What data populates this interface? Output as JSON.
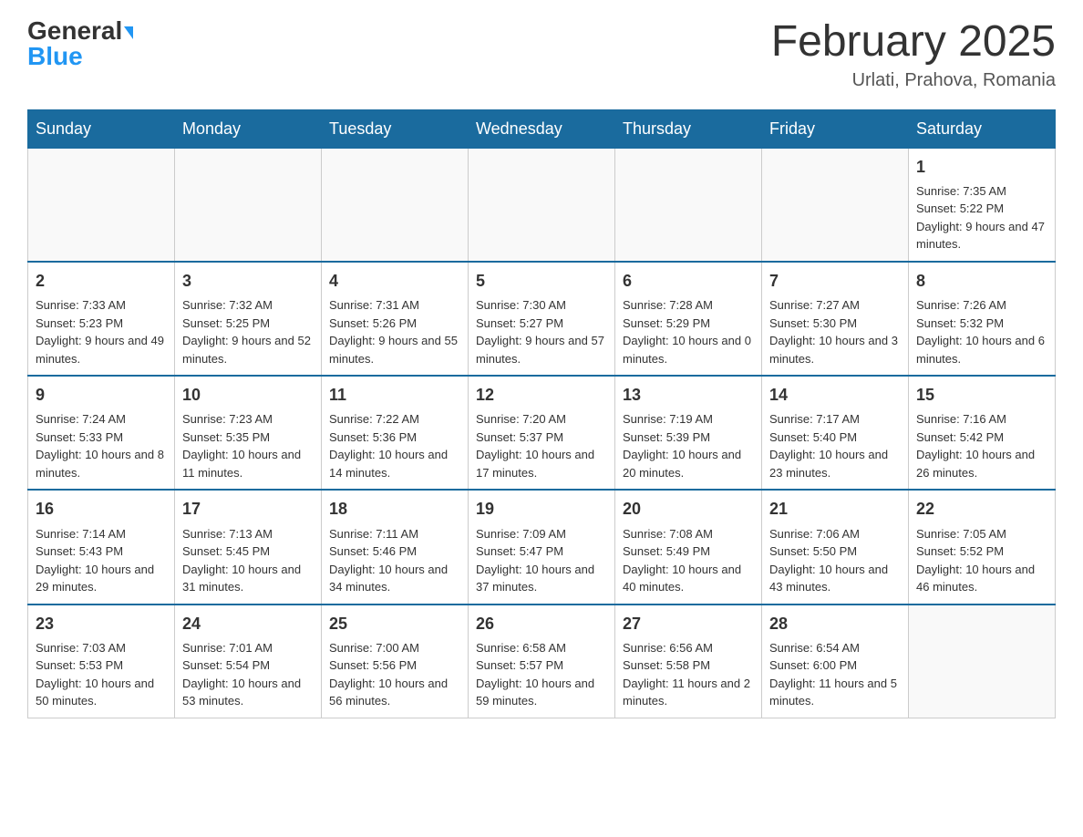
{
  "header": {
    "logo_general": "General",
    "logo_blue": "Blue",
    "month_year": "February 2025",
    "location": "Urlati, Prahova, Romania"
  },
  "days_of_week": [
    "Sunday",
    "Monday",
    "Tuesday",
    "Wednesday",
    "Thursday",
    "Friday",
    "Saturday"
  ],
  "weeks": [
    [
      {
        "day": "",
        "info": ""
      },
      {
        "day": "",
        "info": ""
      },
      {
        "day": "",
        "info": ""
      },
      {
        "day": "",
        "info": ""
      },
      {
        "day": "",
        "info": ""
      },
      {
        "day": "",
        "info": ""
      },
      {
        "day": "1",
        "info": "Sunrise: 7:35 AM\nSunset: 5:22 PM\nDaylight: 9 hours and 47 minutes."
      }
    ],
    [
      {
        "day": "2",
        "info": "Sunrise: 7:33 AM\nSunset: 5:23 PM\nDaylight: 9 hours and 49 minutes."
      },
      {
        "day": "3",
        "info": "Sunrise: 7:32 AM\nSunset: 5:25 PM\nDaylight: 9 hours and 52 minutes."
      },
      {
        "day": "4",
        "info": "Sunrise: 7:31 AM\nSunset: 5:26 PM\nDaylight: 9 hours and 55 minutes."
      },
      {
        "day": "5",
        "info": "Sunrise: 7:30 AM\nSunset: 5:27 PM\nDaylight: 9 hours and 57 minutes."
      },
      {
        "day": "6",
        "info": "Sunrise: 7:28 AM\nSunset: 5:29 PM\nDaylight: 10 hours and 0 minutes."
      },
      {
        "day": "7",
        "info": "Sunrise: 7:27 AM\nSunset: 5:30 PM\nDaylight: 10 hours and 3 minutes."
      },
      {
        "day": "8",
        "info": "Sunrise: 7:26 AM\nSunset: 5:32 PM\nDaylight: 10 hours and 6 minutes."
      }
    ],
    [
      {
        "day": "9",
        "info": "Sunrise: 7:24 AM\nSunset: 5:33 PM\nDaylight: 10 hours and 8 minutes."
      },
      {
        "day": "10",
        "info": "Sunrise: 7:23 AM\nSunset: 5:35 PM\nDaylight: 10 hours and 11 minutes."
      },
      {
        "day": "11",
        "info": "Sunrise: 7:22 AM\nSunset: 5:36 PM\nDaylight: 10 hours and 14 minutes."
      },
      {
        "day": "12",
        "info": "Sunrise: 7:20 AM\nSunset: 5:37 PM\nDaylight: 10 hours and 17 minutes."
      },
      {
        "day": "13",
        "info": "Sunrise: 7:19 AM\nSunset: 5:39 PM\nDaylight: 10 hours and 20 minutes."
      },
      {
        "day": "14",
        "info": "Sunrise: 7:17 AM\nSunset: 5:40 PM\nDaylight: 10 hours and 23 minutes."
      },
      {
        "day": "15",
        "info": "Sunrise: 7:16 AM\nSunset: 5:42 PM\nDaylight: 10 hours and 26 minutes."
      }
    ],
    [
      {
        "day": "16",
        "info": "Sunrise: 7:14 AM\nSunset: 5:43 PM\nDaylight: 10 hours and 29 minutes."
      },
      {
        "day": "17",
        "info": "Sunrise: 7:13 AM\nSunset: 5:45 PM\nDaylight: 10 hours and 31 minutes."
      },
      {
        "day": "18",
        "info": "Sunrise: 7:11 AM\nSunset: 5:46 PM\nDaylight: 10 hours and 34 minutes."
      },
      {
        "day": "19",
        "info": "Sunrise: 7:09 AM\nSunset: 5:47 PM\nDaylight: 10 hours and 37 minutes."
      },
      {
        "day": "20",
        "info": "Sunrise: 7:08 AM\nSunset: 5:49 PM\nDaylight: 10 hours and 40 minutes."
      },
      {
        "day": "21",
        "info": "Sunrise: 7:06 AM\nSunset: 5:50 PM\nDaylight: 10 hours and 43 minutes."
      },
      {
        "day": "22",
        "info": "Sunrise: 7:05 AM\nSunset: 5:52 PM\nDaylight: 10 hours and 46 minutes."
      }
    ],
    [
      {
        "day": "23",
        "info": "Sunrise: 7:03 AM\nSunset: 5:53 PM\nDaylight: 10 hours and 50 minutes."
      },
      {
        "day": "24",
        "info": "Sunrise: 7:01 AM\nSunset: 5:54 PM\nDaylight: 10 hours and 53 minutes."
      },
      {
        "day": "25",
        "info": "Sunrise: 7:00 AM\nSunset: 5:56 PM\nDaylight: 10 hours and 56 minutes."
      },
      {
        "day": "26",
        "info": "Sunrise: 6:58 AM\nSunset: 5:57 PM\nDaylight: 10 hours and 59 minutes."
      },
      {
        "day": "27",
        "info": "Sunrise: 6:56 AM\nSunset: 5:58 PM\nDaylight: 11 hours and 2 minutes."
      },
      {
        "day": "28",
        "info": "Sunrise: 6:54 AM\nSunset: 6:00 PM\nDaylight: 11 hours and 5 minutes."
      },
      {
        "day": "",
        "info": ""
      }
    ]
  ]
}
